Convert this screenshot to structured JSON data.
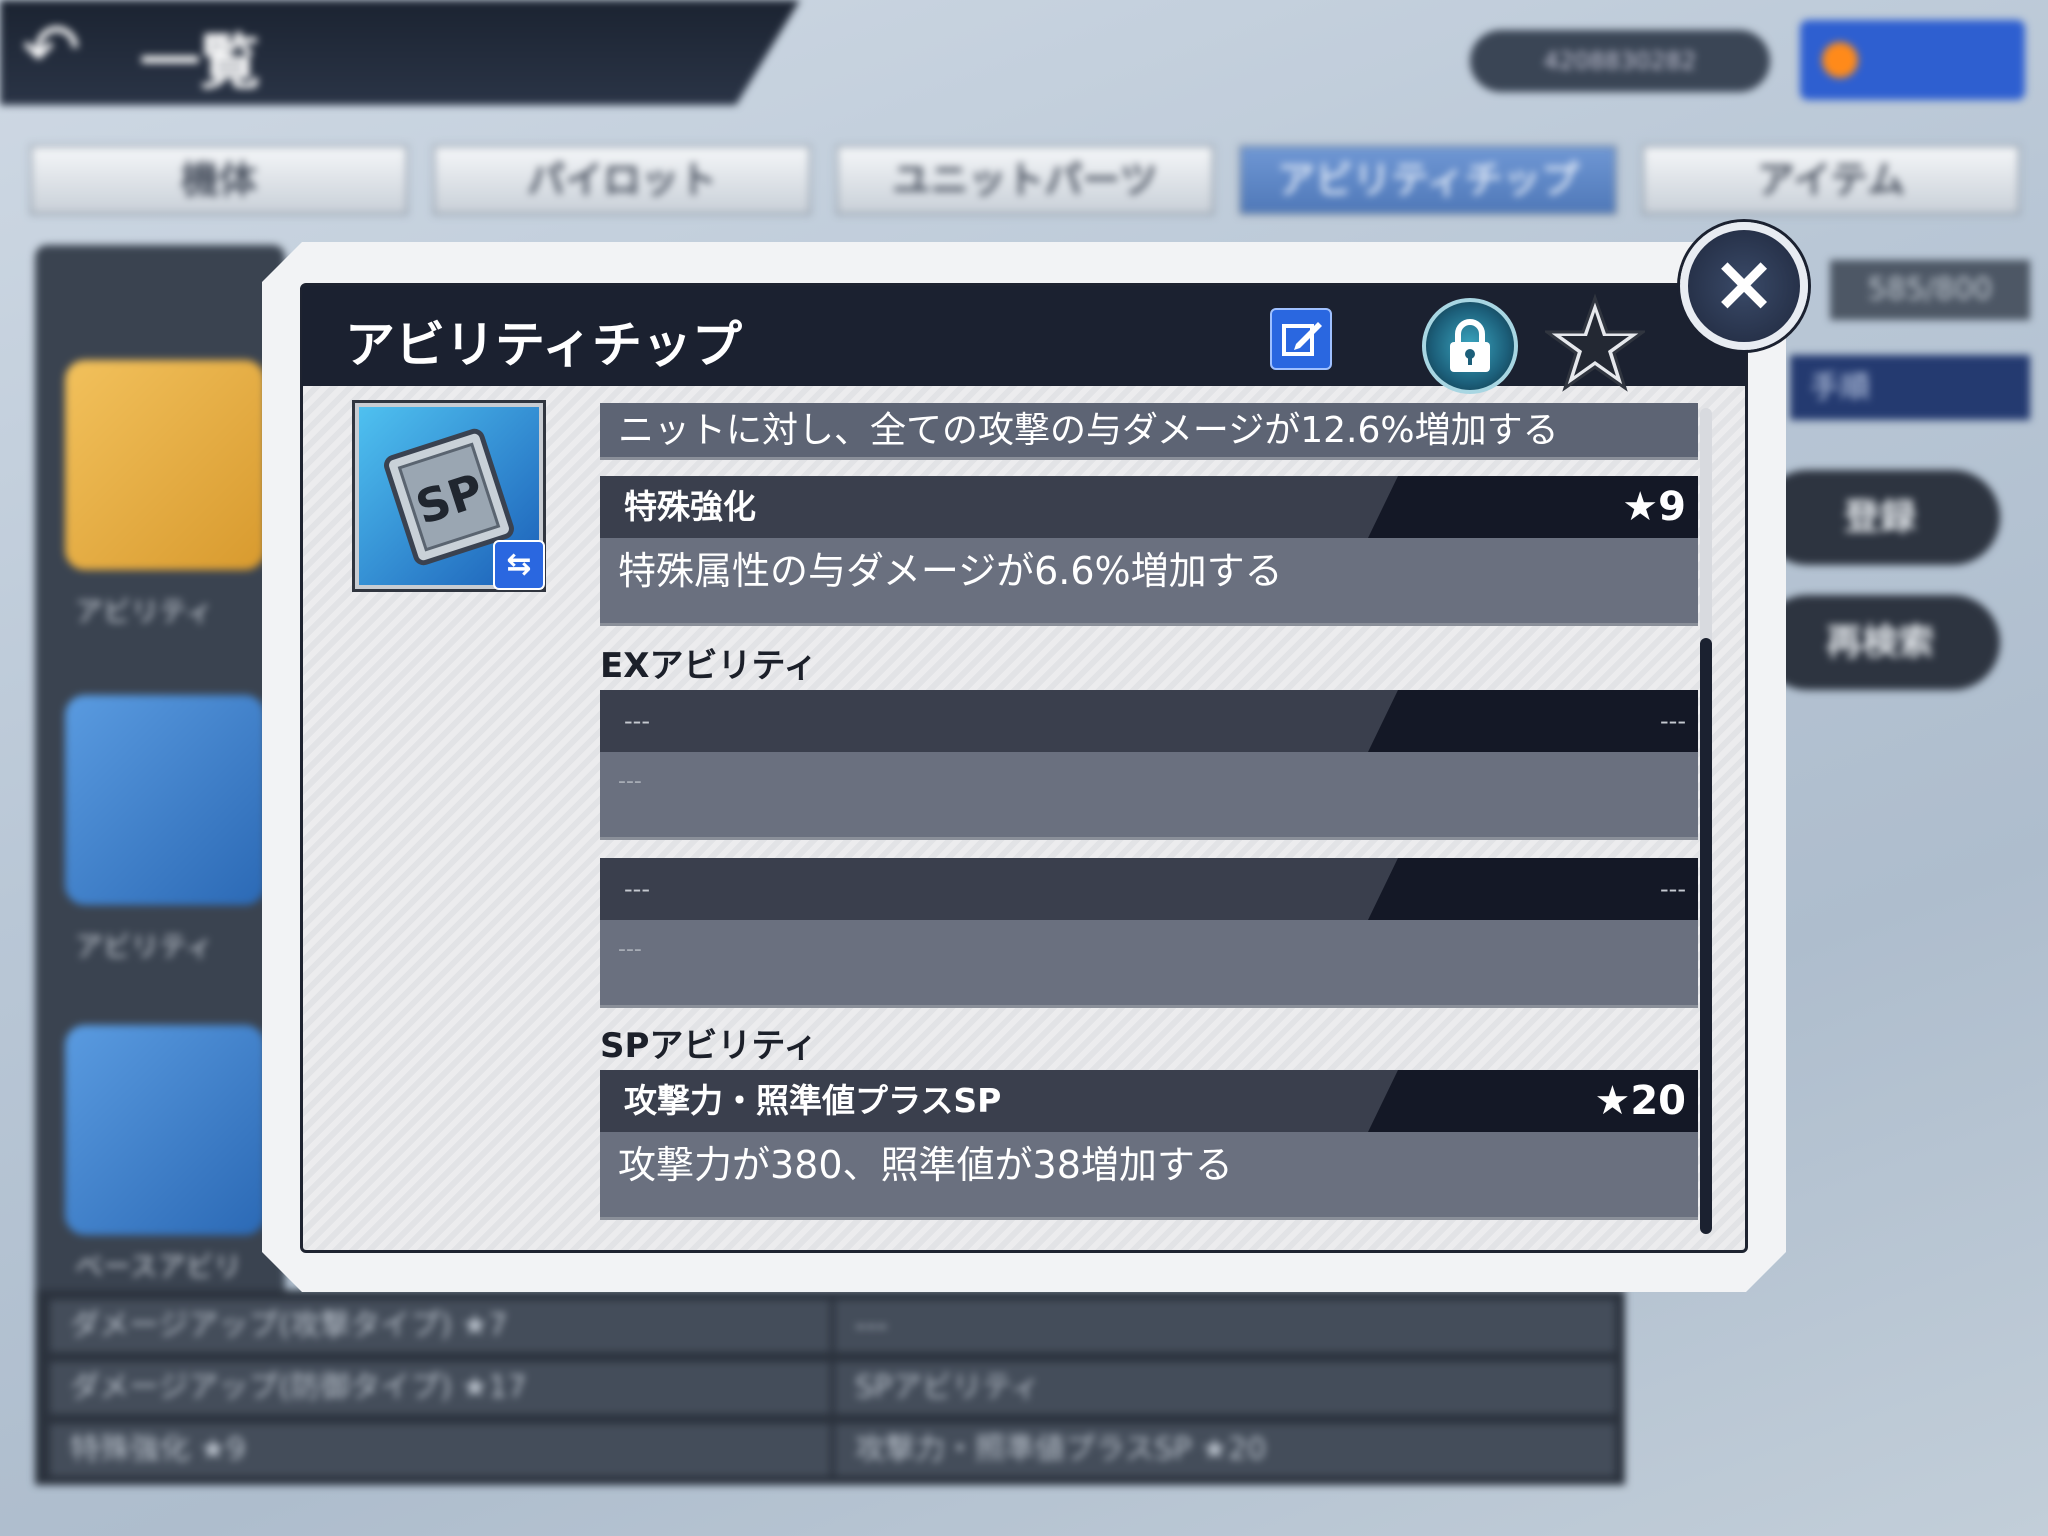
{
  "header": {
    "title": "一覧",
    "player_id": "4208830282",
    "back_icon": "back-arrow-icon"
  },
  "tabs": [
    {
      "label": "機体",
      "active": false
    },
    {
      "label": "パイロット",
      "active": false
    },
    {
      "label": "ユニットパーツ",
      "active": false
    },
    {
      "label": "アビリティチップ",
      "active": true
    },
    {
      "label": "アイテム",
      "active": false
    }
  ],
  "background": {
    "count": "585/800",
    "sort_label": "手順",
    "buttons": [
      "登録",
      "再検索"
    ],
    "cards": [
      "アビリティ",
      "アビリティ",
      "ベースアビリ"
    ],
    "list_left": [
      {
        "name": "ダメージアップ(攻撃タイプ)",
        "rank": "★7"
      },
      {
        "name": "ダメージアップ(防御タイプ)",
        "rank": "★17"
      },
      {
        "name": "特殊強化",
        "rank": "★9"
      }
    ],
    "list_right": [
      {
        "name": "---",
        "rank": ""
      },
      {
        "name": "SPアビリティ",
        "rank": ""
      },
      {
        "name": "攻撃力・照準値プラスSP",
        "rank": "★20"
      }
    ]
  },
  "dialog": {
    "title": "アビリティチップ",
    "close_label": "×",
    "icons": {
      "edit": "edit-icon",
      "lock": "lock-icon",
      "favorite": "star-icon",
      "swap": "swap-icon"
    },
    "chip_label": "SP",
    "partial_desc": "ニットに対し、全ての攻撃の与ダメージが12.6%増加する",
    "base_ability": {
      "name": "特殊強化",
      "rank": "★9",
      "desc": "特殊属性の与ダメージが6.6%増加する"
    },
    "ex_label": "EXアビリティ",
    "ex_abilities": [
      {
        "name": "---",
        "rank": "---",
        "desc": "---"
      },
      {
        "name": "---",
        "rank": "---",
        "desc": "---"
      }
    ],
    "sp_label": "SPアビリティ",
    "sp_ability": {
      "name": "攻撃力・照準値プラスSP",
      "rank": "★20",
      "desc": "攻撃力が380、照準値が38増加する"
    }
  },
  "colors": {
    "header_dark": "#1b2130",
    "accent_blue": "#2a67e0",
    "row_gray": "#6a707f"
  }
}
